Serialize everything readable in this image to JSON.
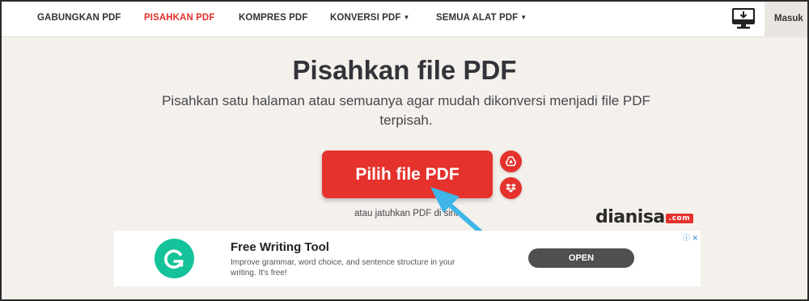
{
  "nav": {
    "items": [
      {
        "label": "GABUNGKAN PDF",
        "active": false,
        "dropdown": false
      },
      {
        "label": "PISAHKAN PDF",
        "active": true,
        "dropdown": false
      },
      {
        "label": "KOMPRES PDF",
        "active": false,
        "dropdown": false
      },
      {
        "label": "KONVERSI PDF",
        "active": false,
        "dropdown": true
      },
      {
        "label": "SEMUA ALAT PDF",
        "active": false,
        "dropdown": true
      }
    ],
    "download_icon": "desktop-download-icon",
    "login_label": "Masuk"
  },
  "hero": {
    "title": "Pisahkan file PDF",
    "subtitle": "Pisahkan satu halaman atau semuanya agar mudah dikonversi menjadi file PDF terpisah."
  },
  "upload": {
    "button_label": "Pilih file PDF",
    "drop_text": "atau jatuhkan PDF di sini",
    "cloud_buttons": [
      {
        "icon": "google-drive-icon"
      },
      {
        "icon": "dropbox-icon"
      }
    ]
  },
  "watermark": {
    "text": "dianisa",
    "suffix": ".com"
  },
  "ad": {
    "title": "Free Writing Tool",
    "description": "Improve grammar, word choice, and sentence structure in your writing. It's free!",
    "button_label": "OPEN",
    "info_icon": "ⓘ ✕"
  },
  "colors": {
    "accent": "#e5322d",
    "background": "#f4f0eb",
    "annotation_arrow": "#3fb5e8",
    "ad_logo": "#15c39a"
  }
}
